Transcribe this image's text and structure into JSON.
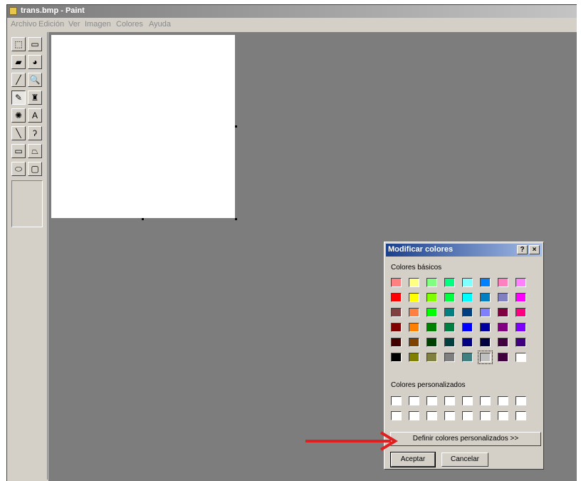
{
  "window": {
    "title": "trans.bmp - Paint",
    "icon": "paint-app-icon"
  },
  "menu": [
    "Archivo",
    "Edición",
    "Ver",
    "Imagen",
    "Colores",
    "Ayuda"
  ],
  "tools": [
    {
      "name": "free-select-icon",
      "glyph": "⬚"
    },
    {
      "name": "rect-select-icon",
      "glyph": "▭"
    },
    {
      "name": "eraser-icon",
      "glyph": "▰"
    },
    {
      "name": "fill-bucket-icon",
      "glyph": "◕"
    },
    {
      "name": "color-picker-icon",
      "glyph": "╱"
    },
    {
      "name": "magnifier-icon",
      "glyph": "🔍"
    },
    {
      "name": "pencil-icon",
      "glyph": "✎"
    },
    {
      "name": "brush-icon",
      "glyph": "♜"
    },
    {
      "name": "airbrush-icon",
      "glyph": "✺"
    },
    {
      "name": "text-icon",
      "glyph": "A"
    },
    {
      "name": "line-icon",
      "glyph": "╲"
    },
    {
      "name": "curve-icon",
      "glyph": "ʔ"
    },
    {
      "name": "rectangle-icon",
      "glyph": "▭"
    },
    {
      "name": "polygon-icon",
      "glyph": "⏢"
    },
    {
      "name": "ellipse-icon",
      "glyph": "⬭"
    },
    {
      "name": "rounded-rect-icon",
      "glyph": "▢"
    }
  ],
  "dialog": {
    "title": "Modificar colores",
    "help_label": "?",
    "close_label": "×",
    "basic_label": "Colores básicos",
    "custom_label": "Colores personalizados",
    "define_button": "Definir colores personalizados >>",
    "ok_button": "Aceptar",
    "cancel_button": "Cancelar",
    "basic_colors": [
      [
        "#ff8080",
        "#ffff80",
        "#80ff80",
        "#00ff80",
        "#80ffff",
        "#0080ff",
        "#ff80c0",
        "#ff80ff"
      ],
      [
        "#ff0000",
        "#ffff00",
        "#80ff00",
        "#00ff40",
        "#00ffff",
        "#0080c0",
        "#8080c0",
        "#ff00ff"
      ],
      [
        "#804040",
        "#ff8040",
        "#00ff00",
        "#008080",
        "#004080",
        "#8080ff",
        "#800040",
        "#ff0080"
      ],
      [
        "#800000",
        "#ff8000",
        "#008000",
        "#008040",
        "#0000ff",
        "#0000a0",
        "#800080",
        "#8000ff"
      ],
      [
        "#400000",
        "#804000",
        "#004000",
        "#004040",
        "#000080",
        "#000040",
        "#400040",
        "#400080"
      ],
      [
        "#000000",
        "#808000",
        "#808040",
        "#808080",
        "#408080",
        "#c0c0c0",
        "#400040",
        "#ffffff"
      ]
    ],
    "selected_basic": [
      5,
      5
    ],
    "custom_colors": [
      [
        "#ffffff",
        "#ffffff",
        "#ffffff",
        "#ffffff",
        "#ffffff",
        "#ffffff",
        "#ffffff",
        "#ffffff"
      ],
      [
        "#ffffff",
        "#ffffff",
        "#ffffff",
        "#ffffff",
        "#ffffff",
        "#ffffff",
        "#ffffff",
        "#ffffff"
      ]
    ]
  },
  "colors": {
    "workspace": "#7d7d7d",
    "annotation_arrow": "#e02020"
  }
}
